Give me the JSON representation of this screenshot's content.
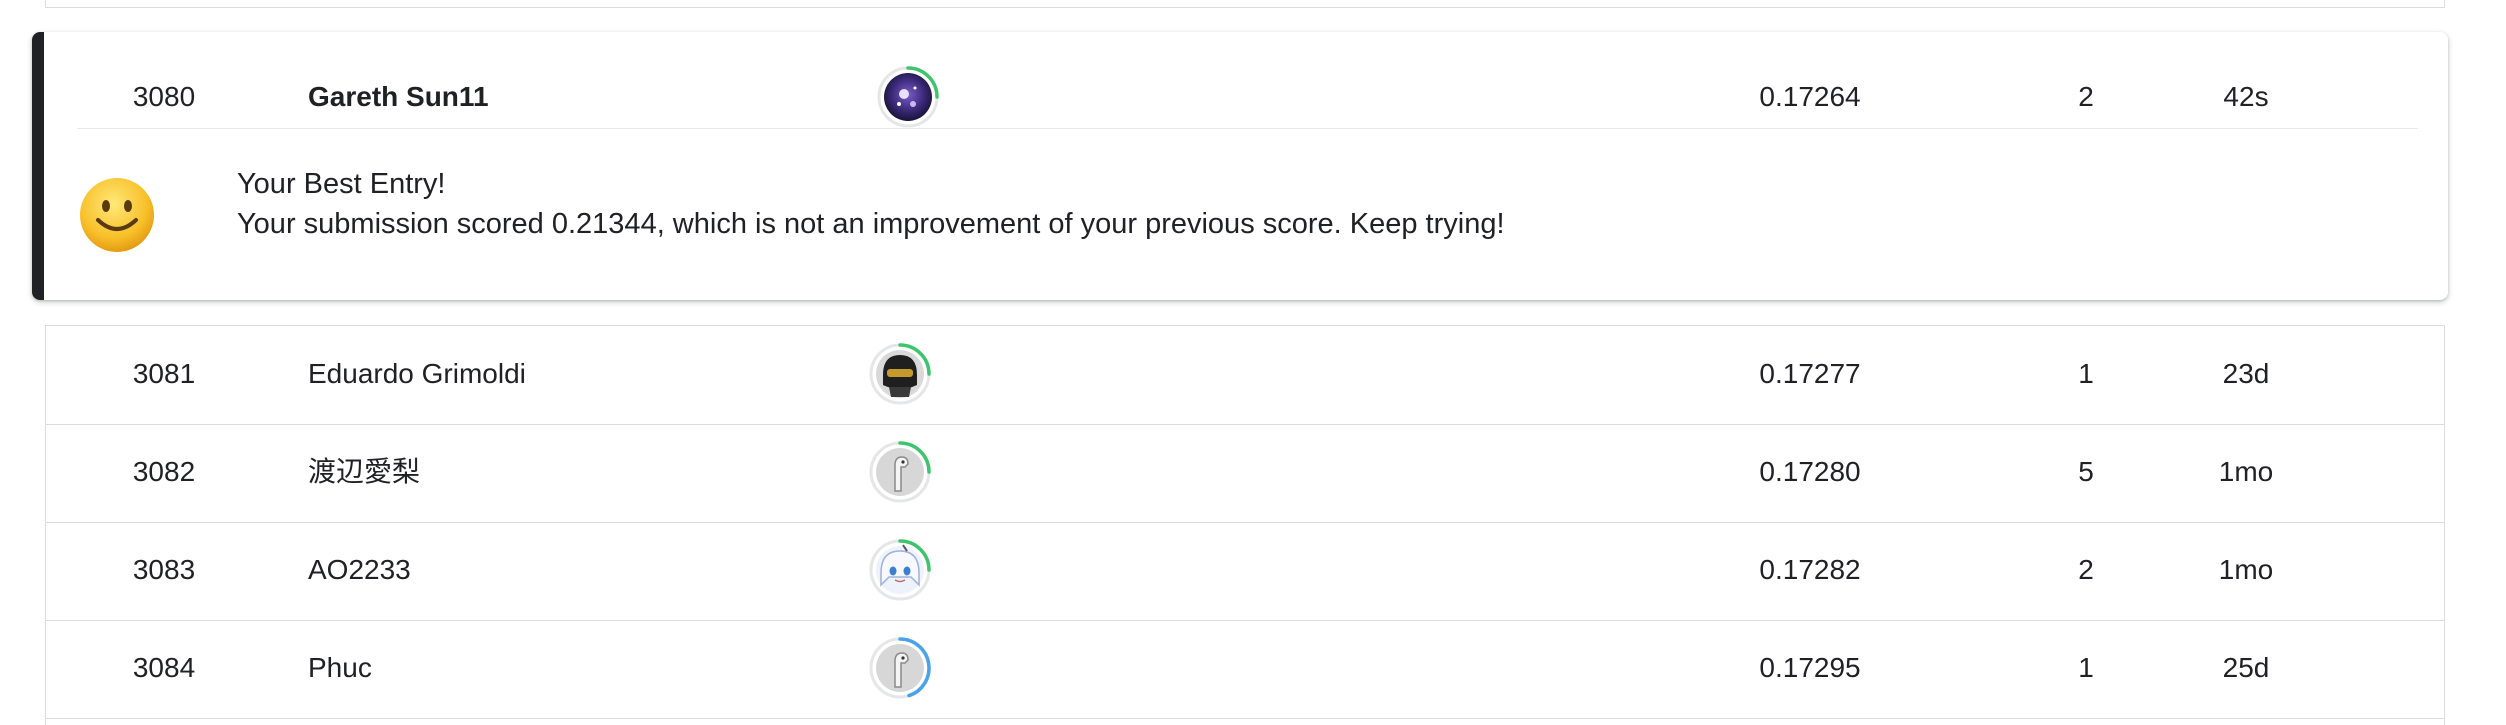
{
  "current_entry": {
    "rank": "3080",
    "name": "Gareth Sun11",
    "score": "0.17264",
    "entries": "2",
    "last": "42s",
    "avatar": {
      "style": "space",
      "ring_color": "#3ec46d",
      "ring_fraction": 0.25
    },
    "message": {
      "icon": "smiley-face-icon",
      "title": "Your Best Entry!",
      "body": "Your submission scored 0.21344, which is not an improvement of your previous score. Keep trying!"
    }
  },
  "rows": [
    {
      "rank": "3081",
      "name": "Eduardo Grimoldi",
      "score": "0.17277",
      "entries": "1",
      "last": "23d",
      "avatar": {
        "style": "helmet",
        "ring_color": "#3ec46d",
        "ring_fraction": 0.25
      }
    },
    {
      "rank": "3082",
      "name": "渡辺愛梨",
      "score": "0.17280",
      "entries": "5",
      "last": "1mo",
      "avatar": {
        "style": "bird",
        "ring_color": "#3ec46d",
        "ring_fraction": 0.25
      }
    },
    {
      "rank": "3083",
      "name": "AO2233",
      "score": "0.17282",
      "entries": "2",
      "last": "1mo",
      "avatar": {
        "style": "anime",
        "ring_color": "#3ec46d",
        "ring_fraction": 0.25
      }
    },
    {
      "rank": "3084",
      "name": "Phuc",
      "score": "0.17295",
      "entries": "1",
      "last": "25d",
      "avatar": {
        "style": "bird",
        "ring_color": "#4aa3e8",
        "ring_fraction": 0.45
      }
    }
  ],
  "colors": {
    "accent": "#202124",
    "border": "#dadce0",
    "text": "#202124"
  }
}
